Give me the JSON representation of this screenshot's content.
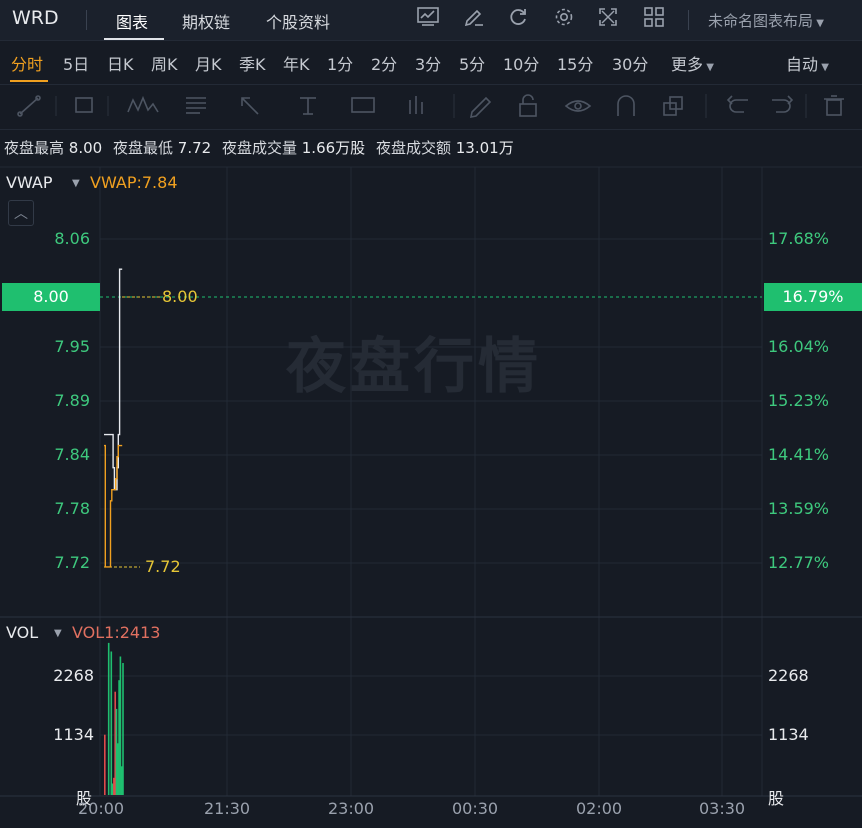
{
  "header": {
    "ticker": "WRD",
    "tabs": [
      {
        "label": "图表",
        "active": true
      },
      {
        "label": "期权链",
        "active": false
      },
      {
        "label": "个股资料",
        "active": false
      }
    ],
    "icons": [
      "chart-line-icon",
      "draw-pen-icon",
      "refresh-icon",
      "gear-icon",
      "fullscreen-icon",
      "grid-layout-icon"
    ],
    "layout_name": "未命名图表布局"
  },
  "periods": {
    "items": [
      "分时",
      "5日",
      "日K",
      "周K",
      "月K",
      "季K",
      "年K",
      "1分",
      "2分",
      "3分",
      "5分",
      "10分",
      "15分",
      "30分",
      "更多"
    ],
    "active": "分时",
    "scale_mode": "自动"
  },
  "tools": [
    "line-tool-icon",
    "rect-tool-icon",
    "wave-tool-icon",
    "fib-tool-icon",
    "arrow-tool-icon",
    "text-tool-icon",
    "label-tool-icon",
    "bar-tool-icon",
    "pen-tool-icon",
    "lock-icon",
    "eye-icon",
    "magnet-icon",
    "layers-icon",
    "undo-icon",
    "redo-icon",
    "trash-icon"
  ],
  "stats": {
    "high_label": "夜盘最高",
    "high": "8.00",
    "low_label": "夜盘最低",
    "low": "7.72",
    "volume_label": "夜盘成交量",
    "volume": "1.66万股",
    "amount_label": "夜盘成交额",
    "amount": "13.01万"
  },
  "price_panel": {
    "indicator": "VWAP",
    "indicator_value": "VWAP:7.84",
    "watermark": "夜盘行情",
    "price_labels": [
      "8.06",
      "8.00",
      "7.95",
      "7.89",
      "7.84",
      "7.78",
      "7.72"
    ],
    "pct_labels": [
      "17.68%",
      "16.79%",
      "16.04%",
      "15.23%",
      "14.41%",
      "13.59%",
      "12.77%"
    ],
    "current_price": "8.00",
    "current_pct": "16.79%",
    "high_marker": "8.00",
    "low_marker": "7.72",
    "colors": {
      "up": "#1fbf6f",
      "price_line": "#e6e9ee",
      "vwap_line": "#f0a020",
      "marker": "#e6c636"
    }
  },
  "volume_panel": {
    "indicator": "VOL",
    "indicator_value": "VOL1:2413",
    "labels": [
      "2268",
      "1134"
    ],
    "unit": "股",
    "colors": {
      "up": "#1fbf6f",
      "down": "#e04b4b"
    }
  },
  "time_axis": [
    "20:00",
    "21:30",
    "23:00",
    "00:30",
    "02:00",
    "03:30"
  ],
  "chart_data": {
    "type": "line",
    "x": [
      "20:00",
      "20:01",
      "20:02",
      "20:03",
      "20:04",
      "20:05",
      "20:06",
      "20:07",
      "20:08",
      "20:09",
      "20:10",
      "20:11",
      "20:12",
      "20:13",
      "20:14"
    ],
    "series": [
      {
        "name": "",
        "values": [
          7.85,
          7.85,
          7.85,
          7.85,
          7.85,
          7.85,
          7.85,
          7.82,
          7.8,
          7.8,
          7.82,
          7.85,
          8.0,
          8.0,
          8.0
        ]
      },
      {
        "name": "VWAP",
        "values": [
          7.84,
          7.73,
          7.73,
          7.73,
          7.73,
          7.79,
          7.8,
          7.8,
          7.8,
          7.81,
          7.83,
          7.84,
          7.84,
          7.84,
          7.84
        ]
      }
    ],
    "volume": [
      1050,
      0,
      0,
      2650,
      0,
      2500,
      200,
      300,
      1800,
      1500,
      900,
      2000,
      2413,
      500,
      2300
    ],
    "ylim": [
      7.7,
      8.09
    ],
    "vol_ylim": [
      0,
      2700
    ]
  }
}
